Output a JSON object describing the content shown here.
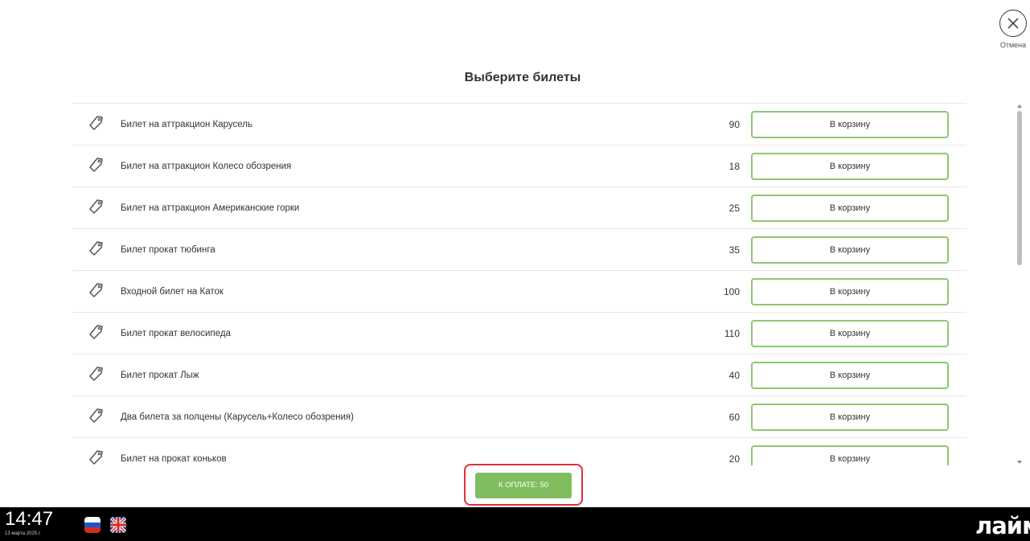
{
  "header": {
    "cancel_label": "Отмена",
    "title": "Выберите билеты"
  },
  "tickets": [
    {
      "name": "Билет на аттракцион Карусель",
      "price": "90",
      "button": "В корзину"
    },
    {
      "name": "Билет на аттракцион Колесо обозрения",
      "price": "18",
      "button": "В корзину"
    },
    {
      "name": "Билет на аттракцион Американские горки",
      "price": "25",
      "button": "В корзину"
    },
    {
      "name": "Билет прокат тюбинга",
      "price": "35",
      "button": "В корзину"
    },
    {
      "name": "Входной билет на Каток",
      "price": "100",
      "button": "В корзину"
    },
    {
      "name": "Билет прокат велосипеда",
      "price": "110",
      "button": "В корзину"
    },
    {
      "name": "Билет прокат Лыж",
      "price": "40",
      "button": "В корзину"
    },
    {
      "name": "Два билета за полцены (Карусель+Колесо обозрения)",
      "price": "60",
      "button": "В корзину"
    },
    {
      "name": "Билет на прокат коньков",
      "price": "20",
      "button": "В корзину"
    }
  ],
  "footer": {
    "pay_label": "К ОПЛАТЕ: 50"
  },
  "statusbar": {
    "time": "14:47",
    "date": "13 марта 2025 г.",
    "logo": "лайм"
  },
  "colors": {
    "accent_green": "#80bd5e",
    "button_border": "#8cc872",
    "highlight_red": "#e0303a"
  },
  "icons": {
    "ticket": "tag-icon",
    "cancel": "close-circle-icon"
  }
}
